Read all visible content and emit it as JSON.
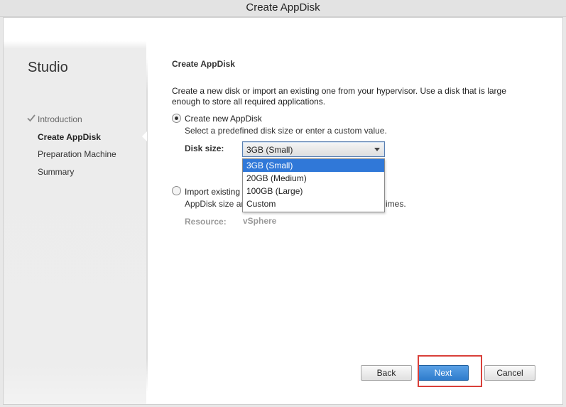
{
  "window": {
    "title": "Create AppDisk"
  },
  "sidebar": {
    "brand": "Studio",
    "items": [
      {
        "label": "Introduction",
        "state": "done"
      },
      {
        "label": "Create AppDisk",
        "state": "active"
      },
      {
        "label": "Preparation Machine",
        "state": "pending"
      },
      {
        "label": "Summary",
        "state": "pending"
      }
    ]
  },
  "main": {
    "title": "Create AppDisk",
    "description": "Create a new disk or import an existing one from your hypervisor. Use a disk that is large enough to store all required applications.",
    "option_new": {
      "label": "Create new AppDisk",
      "hint": "Select a predefined disk size or enter a custom value.",
      "selected": true
    },
    "disk_size": {
      "label": "Disk size:",
      "value": "3GB (Small)",
      "options": [
        "3GB (Small)",
        "20GB (Medium)",
        "100GB (Large)",
        "Custom"
      ]
    },
    "option_import": {
      "label_visible": "Import existing",
      "hint_left": "AppDisk size an",
      "hint_right": "imes.",
      "selected": false
    },
    "resource": {
      "label": "Resource:",
      "value": "vSphere"
    }
  },
  "buttons": {
    "back": "Back",
    "next": "Next",
    "cancel": "Cancel"
  },
  "colors": {
    "accent": "#3078d8",
    "highlight": "#d9403a"
  }
}
